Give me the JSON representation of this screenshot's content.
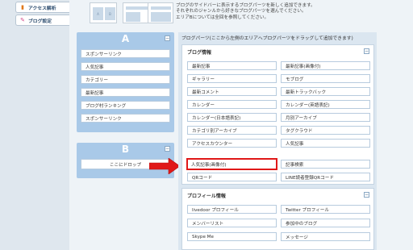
{
  "sidebar": {
    "items": [
      {
        "label": "アクセス解析",
        "icon": "bar-chart-icon"
      },
      {
        "label": "ブログ設定",
        "icon": "wrench-icon"
      }
    ]
  },
  "layout_thumbs": [
    {
      "blocks": [
        "A",
        "B"
      ]
    },
    {
      "blocks": []
    },
    {
      "blocks": []
    }
  ],
  "top_description": {
    "line1": "ブログのサイドバーに表示するブログパーツを新しく追加できます。",
    "line2": "それぞれのジャンルから好きなブログパーツを選んでください。",
    "line3": "エリアBについては全回を参照してください。"
  },
  "columns": {
    "a": {
      "letter": "A",
      "items": [
        "スポンサーリンク",
        "人気記事",
        "カテゴリー",
        "最新記事",
        "ブログ村ランキング",
        "スポンサーリンク"
      ]
    },
    "b": {
      "letter": "B",
      "drop_label": "ここにドロップ"
    }
  },
  "parts_panel": {
    "header": "ブログパーツ(ここから左側のエリアへブログパーツをドラッグして追加できます)",
    "groups": [
      {
        "title": "ブログ情報",
        "items": [
          "最新記事",
          "最新記事(画像付)",
          "ギャラリー",
          "モブログ",
          "最新コメント",
          "最新トラックバック",
          "カレンダー",
          "カレンダー(英語表記)",
          "カレンダー(日本語表記)",
          "月別アーカイブ",
          "カテゴリ別アーカイブ",
          "タグクラウド",
          "アクセスカウンター",
          "人気記事",
          "人気記事(画像付)",
          "記事検索",
          "QRコード",
          "LINE読者登録QRコード"
        ]
      },
      {
        "title": "プロフィール情報",
        "items": [
          "livedoor プロフィール",
          "Twitter プロフィール",
          "メンバーリスト",
          "参加中のブログ",
          "Skype Me",
          "メッセージ"
        ]
      }
    ]
  },
  "minimize_label": "−",
  "colors": {
    "highlight": "#e01818",
    "column_bg": "#a9c9e8",
    "sidebar_bg": "#dfe7ee"
  }
}
